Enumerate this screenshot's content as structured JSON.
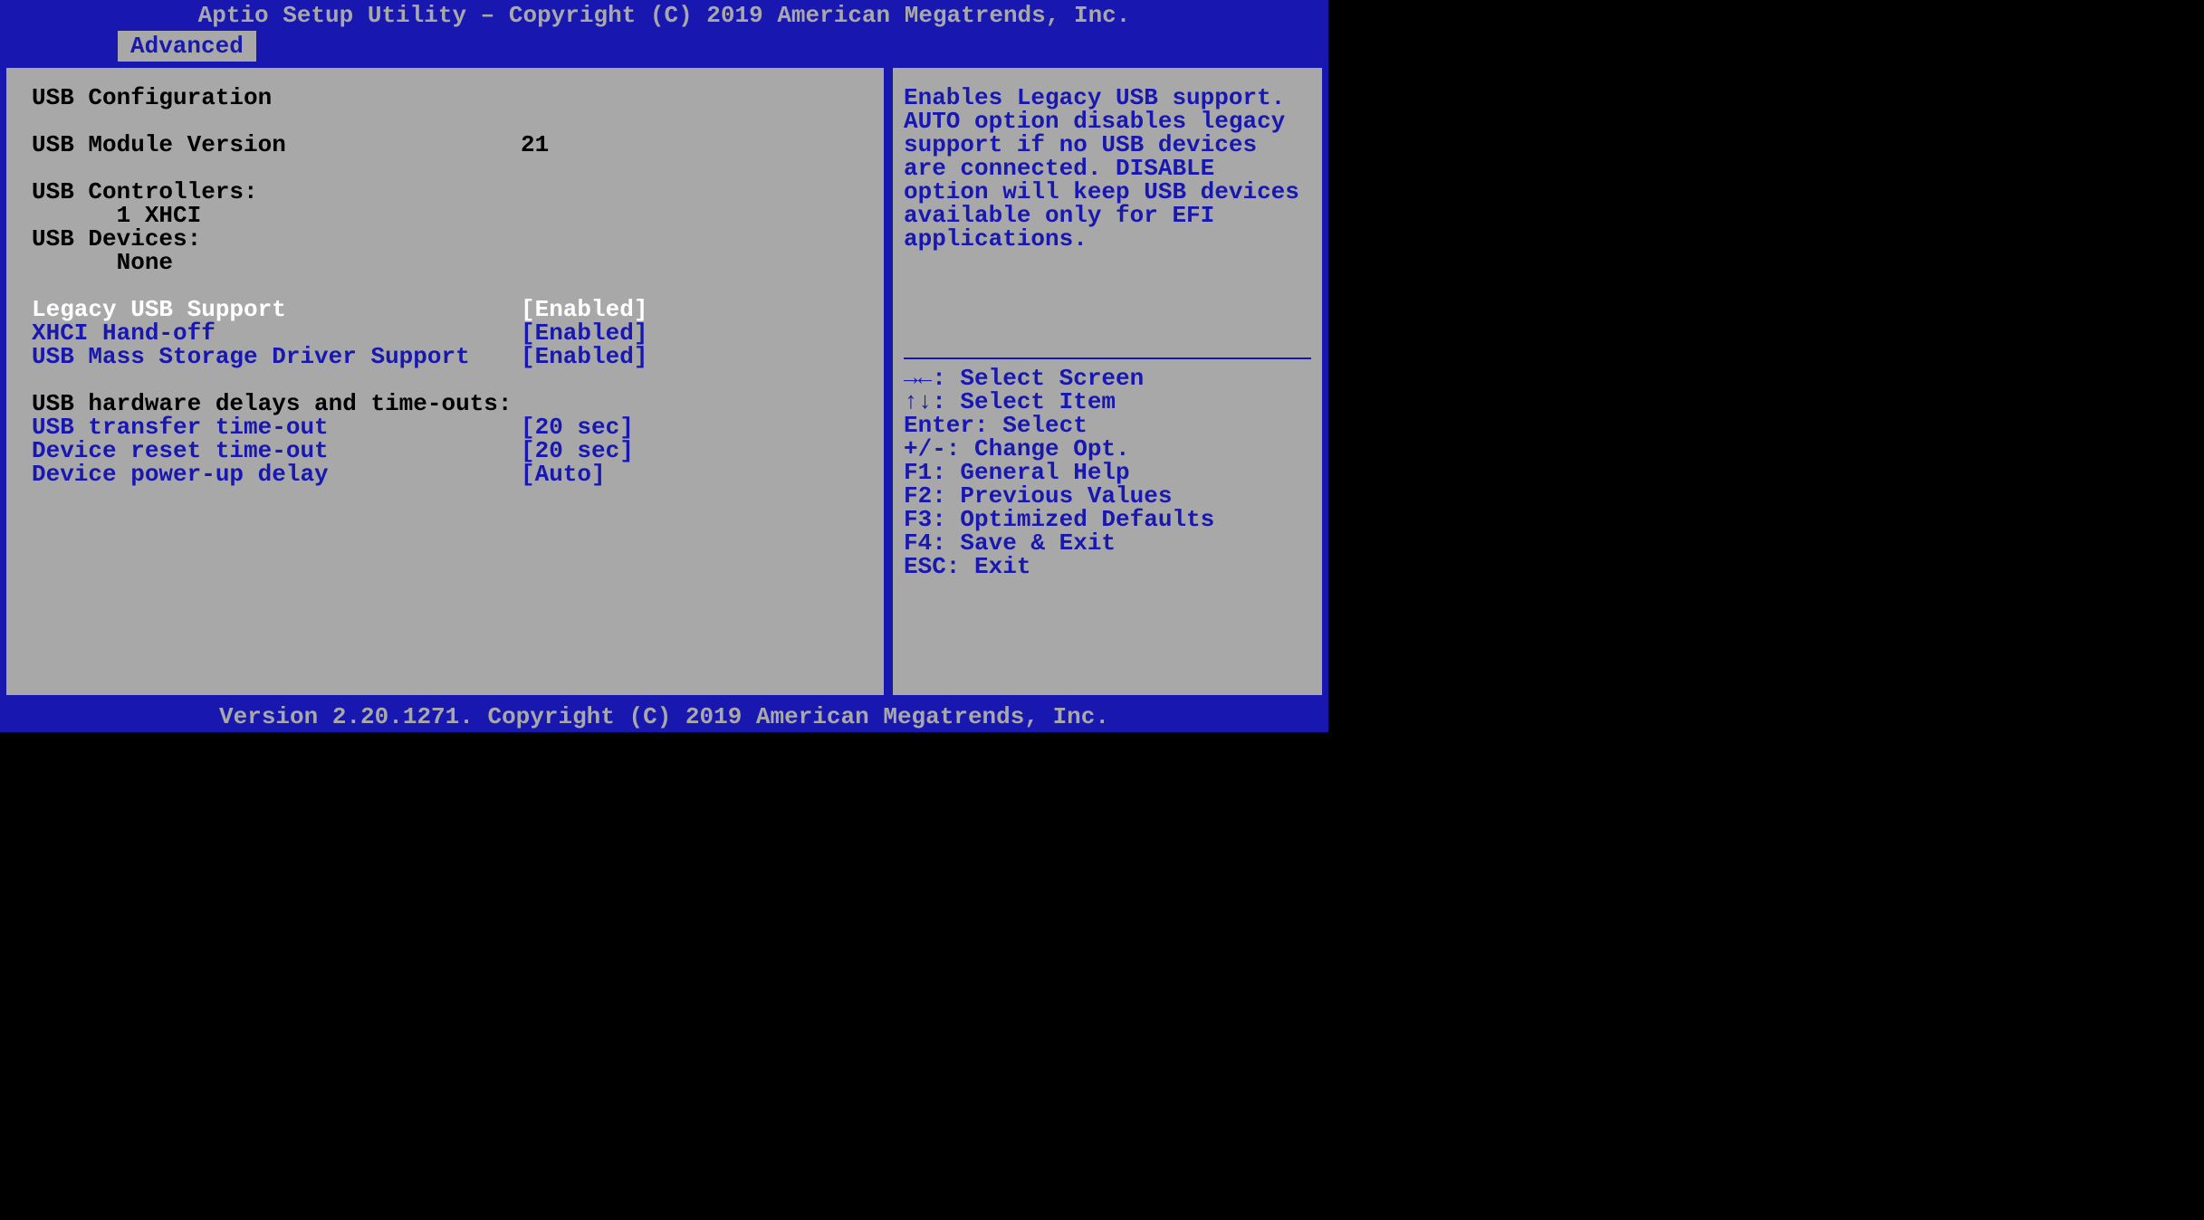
{
  "header": "Aptio Setup Utility – Copyright (C) 2019 American Megatrends, Inc.",
  "tab": "Advanced",
  "panel": {
    "heading": "USB Configuration",
    "module_version_label": "USB Module Version",
    "module_version_value": "21",
    "controllers_label": "USB Controllers:",
    "controllers_value": "      1 XHCI",
    "devices_label": "USB Devices:",
    "devices_value": "      None",
    "options": [
      {
        "label": "Legacy USB Support",
        "value": "[Enabled]",
        "selected": true
      },
      {
        "label": "XHCI Hand-off",
        "value": "[Enabled]",
        "selected": false
      },
      {
        "label": "USB Mass Storage Driver Support",
        "value": "[Enabled]",
        "selected": false
      }
    ],
    "timeouts_heading": "USB hardware delays and time-outs:",
    "timeouts": [
      {
        "label": "USB transfer time-out",
        "value": "[20 sec]"
      },
      {
        "label": "Device reset time-out",
        "value": "[20 sec]"
      },
      {
        "label": "Device power-up delay",
        "value": "[Auto]"
      }
    ]
  },
  "help": "Enables Legacy USB support. AUTO option disables legacy support if no USB devices are connected. DISABLE option will keep USB devices available only for EFI applications.",
  "nav": [
    "→←: Select Screen",
    "↑↓: Select Item",
    "Enter: Select",
    "+/-: Change Opt.",
    "F1: General Help",
    "F2: Previous Values",
    "F3: Optimized Defaults",
    "F4: Save & Exit",
    "ESC: Exit"
  ],
  "footer": "Version 2.20.1271. Copyright (C) 2019 American Megatrends, Inc."
}
